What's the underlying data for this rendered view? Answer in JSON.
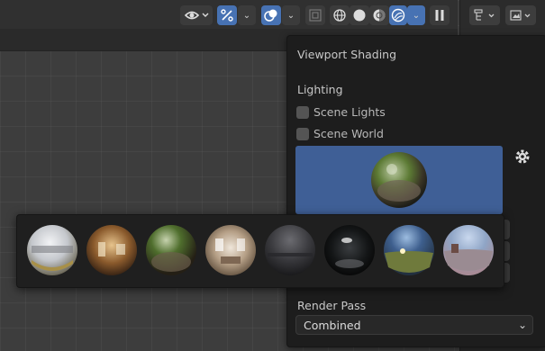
{
  "popover": {
    "title": "Viewport Shading",
    "lighting_label": "Lighting",
    "scene_lights": {
      "label": "Scene Lights",
      "checked": false
    },
    "scene_world": {
      "label": "Scene World",
      "checked": false
    },
    "render_pass_label": "Render Pass",
    "render_pass_value": "Combined"
  },
  "header": {
    "icons": [
      "visibility-eye-icon",
      "gizmo-icon",
      "overlays-icon",
      "xray-icon",
      "wireframe-shading-icon",
      "solid-shading-icon",
      "material-preview-shading-icon",
      "rendered-shading-icon",
      "pause-icon"
    ],
    "active_shading": "material-preview"
  },
  "hdri_thumbnails": [
    {
      "id": "city",
      "selected": false
    },
    {
      "id": "courtyard",
      "selected": false
    },
    {
      "id": "forest",
      "selected": true
    },
    {
      "id": "interior",
      "selected": false
    },
    {
      "id": "night",
      "selected": false
    },
    {
      "id": "studio",
      "selected": false
    },
    {
      "id": "sunrise",
      "selected": false
    },
    {
      "id": "sunset",
      "selected": false
    }
  ],
  "colors": {
    "accent_blue": "#4772b3",
    "preview_bg": "#3f5f96",
    "popover_bg": "#1d1d1d"
  }
}
